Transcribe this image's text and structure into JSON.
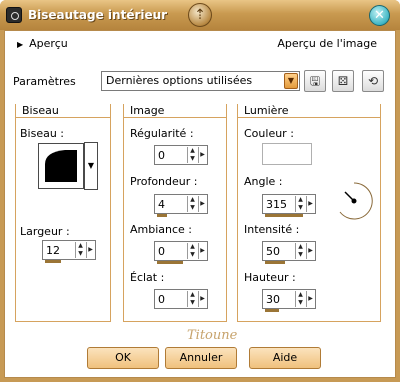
{
  "window": {
    "title": "Biseautage intérieur",
    "icons": {
      "app": "app-camera-icon",
      "center": "help-emblem-icon",
      "close": "close-x-icon"
    }
  },
  "preview": {
    "toggle_label": "Aperçu",
    "image_preview_label": "Aperçu de l'image"
  },
  "params": {
    "label": "Paramètres",
    "preset_value": "Dernières options utilisées",
    "tool_icons": [
      "save-preset-icon",
      "random-dice-icon",
      "reset-preset-icon"
    ]
  },
  "groups": {
    "biseau": {
      "title": "Biseau",
      "biseau_label": "Biseau :",
      "largeur_label": "Largeur :",
      "largeur_value": "12"
    },
    "image": {
      "title": "Image",
      "regularite_label": "Régularité :",
      "regularite_value": "0",
      "profondeur_label": "Profondeur :",
      "profondeur_value": "4",
      "ambiance_label": "Ambiance :",
      "ambiance_value": "0",
      "eclat_label": "Éclat :",
      "eclat_value": "0"
    },
    "lumiere": {
      "title": "Lumière",
      "couleur_label": "Couleur :",
      "couleur_value": "#ffffff",
      "angle_label": "Angle :",
      "angle_value": "315",
      "intensite_label": "Intensité :",
      "intensite_value": "50",
      "hauteur_label": "Hauteur :",
      "hauteur_value": "30"
    }
  },
  "buttons": {
    "ok": "OK",
    "annuler": "Annuler",
    "aide": "Aide"
  },
  "watermark": "Titoune",
  "colors": {
    "frame": "#c79a55",
    "accent": "#9b7536",
    "group_border": "#d6a35f"
  }
}
